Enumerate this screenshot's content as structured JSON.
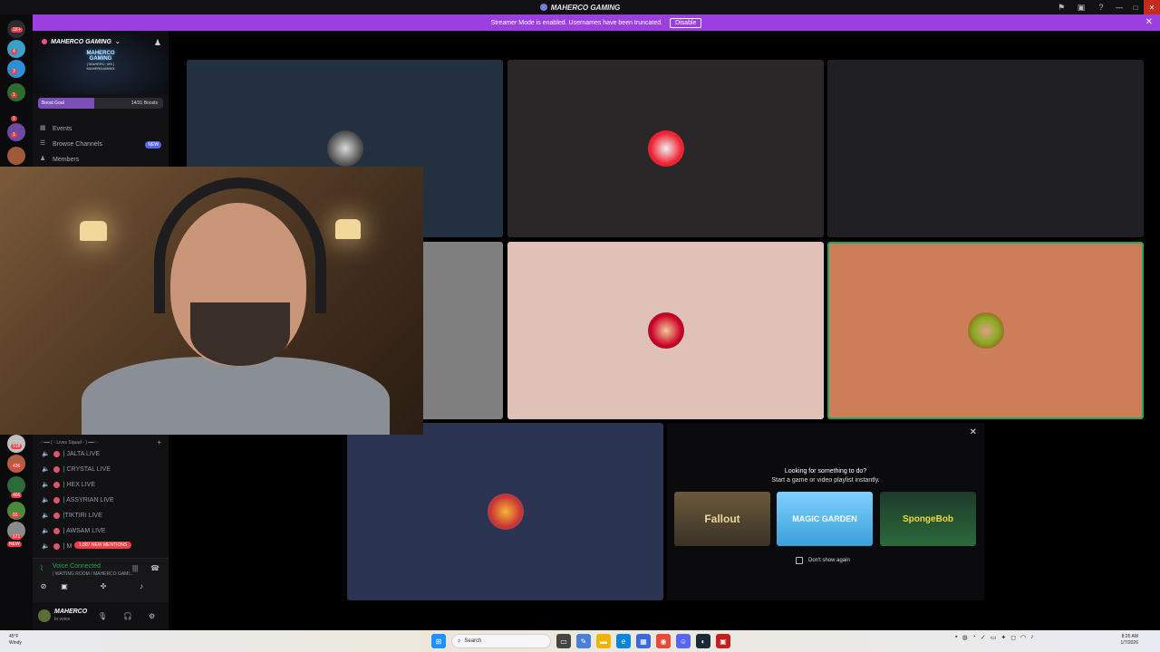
{
  "app": {
    "title": "MAHERCO GAMING",
    "banner_text": "Streamer Mode is enabled. Usernames have been truncated.",
    "banner_button": "Disable"
  },
  "server": {
    "name": "MAHERCO GAMING",
    "logo_text": "MAHERCO",
    "logo_sub": "GAMING",
    "logo_line": "| MAHERO_MX | MAHERGAMING",
    "boost_label": "Boost Goal",
    "boost_count": "14/31 Boosts",
    "boost_fraction": 0.45
  },
  "nav": [
    {
      "label": "Events",
      "icon": "calendar-icon"
    },
    {
      "label": "Browse Channels",
      "icon": "browse-icon",
      "badge": "NEW"
    },
    {
      "label": "Members",
      "icon": "members-icon"
    }
  ],
  "category": "·:·━━ ( ◦ Lives Squad ◦ ) ━━·:·",
  "channels": [
    {
      "label": "| JALTA LIVE"
    },
    {
      "label": "| CRYSTAL LIVE"
    },
    {
      "label": "| HEX LIVE"
    },
    {
      "label": "| ASSYRIAN LIVE"
    },
    {
      "label": "|TIKTIRI LIVE"
    },
    {
      "label": "| AWSAM LIVE"
    },
    {
      "label": "| M"
    }
  ],
  "mentions_badge": "1,887 NEW MENTIONS",
  "rail_badges": [
    "1K+",
    "4",
    "3",
    "1",
    "1",
    "1",
    "918",
    "436",
    "466",
    "93",
    "671"
  ],
  "rail_new": "NEW",
  "voice": {
    "status": "Voice Connected",
    "room": "| WAITING ROOM / MAHERCO GAMI...",
    "username": "MAHERCO",
    "user_status": "In voice"
  },
  "activity": {
    "title": "Looking for something to do?",
    "subtitle": "Start a game or video playlist instantly.",
    "games": [
      "Fallout",
      "MAGIC GARDEN",
      "SpongeBob"
    ],
    "dont_show": "Don't show again"
  },
  "taskbar": {
    "temp": "45°F",
    "weather": "Windy",
    "search": "Search",
    "time": "8:25 AM",
    "date": "1/7/2026"
  },
  "colors": {
    "banner": "#9b3fe0",
    "accent": "#5865f2",
    "voice_green": "#23a55a"
  }
}
